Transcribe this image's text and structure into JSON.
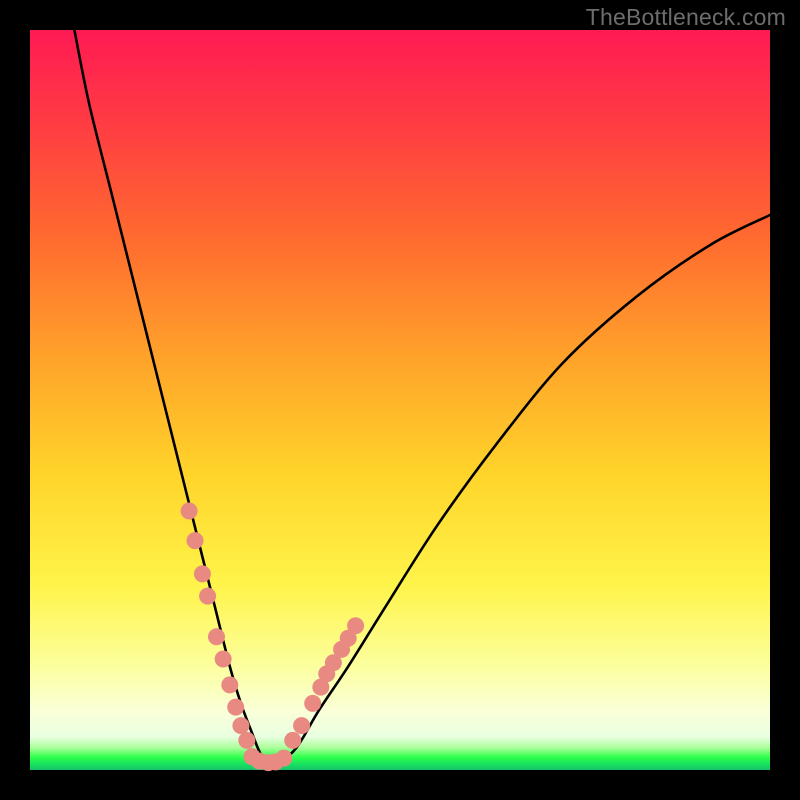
{
  "watermark": "TheBottleneck.com",
  "chart_data": {
    "type": "line",
    "title": "",
    "xlabel": "",
    "ylabel": "",
    "xlim": [
      0,
      100
    ],
    "ylim": [
      0,
      100
    ],
    "grid": false,
    "legend": false,
    "series": [
      {
        "name": "bottleneck-curve",
        "color": "#000000",
        "x": [
          6,
          8,
          11,
          14,
          17,
          20,
          22.5,
          25,
          27,
          28.5,
          30,
          31,
          32,
          33.5,
          36,
          39,
          43,
          48,
          55,
          63,
          72,
          82,
          92,
          100
        ],
        "y": [
          100,
          90,
          78,
          66,
          54,
          42,
          32,
          22,
          14,
          9,
          5,
          2.5,
          1,
          1,
          3,
          8,
          14,
          22,
          33,
          44,
          55,
          64,
          71,
          75
        ]
      },
      {
        "name": "highlight-dots-left",
        "color": "#e98a82",
        "x": [
          21.5,
          22.3,
          23.3,
          24.0,
          25.2,
          26.1,
          27.0,
          27.8,
          28.5,
          29.3
        ],
        "y": [
          35,
          31,
          26.5,
          23.5,
          18,
          15,
          11.5,
          8.5,
          6,
          4
        ]
      },
      {
        "name": "highlight-dots-bottom",
        "color": "#e98a82",
        "x": [
          30.0,
          31.0,
          32.2,
          33.2,
          34.3
        ],
        "y": [
          1.8,
          1.2,
          1.0,
          1.1,
          1.6
        ]
      },
      {
        "name": "highlight-dots-right",
        "color": "#e98a82",
        "x": [
          35.5,
          36.7,
          38.2,
          39.3,
          40.1,
          41.0,
          42.1,
          43.0,
          44.0
        ],
        "y": [
          4.0,
          6.0,
          9.0,
          11.2,
          13.0,
          14.5,
          16.3,
          17.8,
          19.5
        ]
      }
    ],
    "gradient_stops": [
      {
        "pos": 0,
        "color": "#ff1a53"
      },
      {
        "pos": 12,
        "color": "#ff3a44"
      },
      {
        "pos": 28,
        "color": "#ff6a2f"
      },
      {
        "pos": 45,
        "color": "#ffa52a"
      },
      {
        "pos": 60,
        "color": "#ffd42a"
      },
      {
        "pos": 75,
        "color": "#fff44a"
      },
      {
        "pos": 86,
        "color": "#fcff9e"
      },
      {
        "pos": 92,
        "color": "#faffd8"
      },
      {
        "pos": 95.5,
        "color": "#e9ffe0"
      },
      {
        "pos": 97,
        "color": "#aaff9a"
      },
      {
        "pos": 98.3,
        "color": "#2bff4a"
      },
      {
        "pos": 99.2,
        "color": "#18e25f"
      },
      {
        "pos": 100,
        "color": "#17c26c"
      }
    ]
  }
}
